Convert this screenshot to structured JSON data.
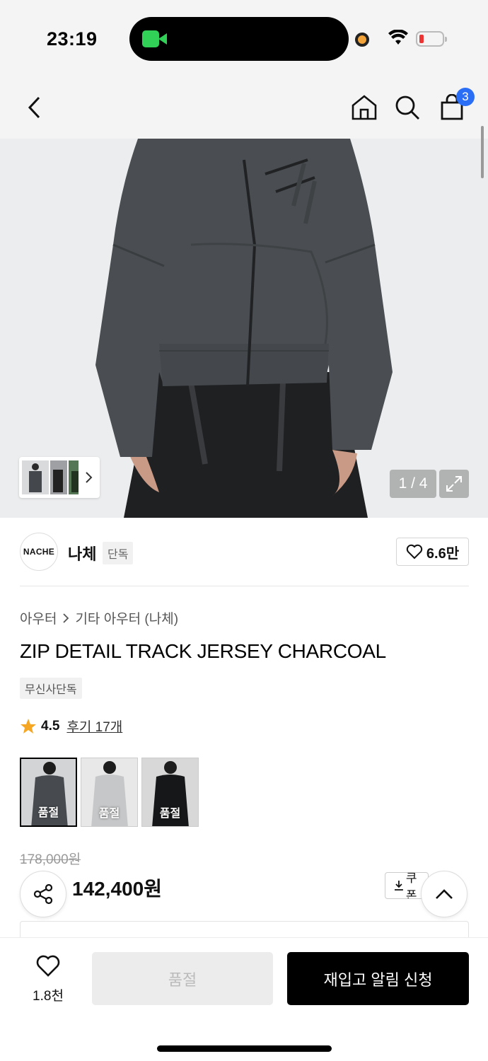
{
  "status": {
    "time": "23:19"
  },
  "nav": {
    "cart_count": "3"
  },
  "gallery": {
    "counter": "1 / 4"
  },
  "brand": {
    "logo_text": "NACHE",
    "name": "나체",
    "exclusive_badge": "단독",
    "likes": "6.6만"
  },
  "breadcrumb": {
    "category": "아우터",
    "subcategory": "기타 아우터 (나체)"
  },
  "product": {
    "title": "ZIP DETAIL TRACK JERSEY CHARCOAL",
    "badge": "무신사단독",
    "rating": "4.5",
    "reviews": "후기 17개",
    "color_options": [
      {
        "label": "품절",
        "selected": true
      },
      {
        "label": "품절",
        "selected": false
      },
      {
        "label": "품절",
        "selected": false
      }
    ],
    "original_price": "178,000원",
    "sale_price": "142,400원",
    "coupon_label": "쿠폰"
  },
  "bottom": {
    "wish_count": "1.8천",
    "soldout_label": "품절",
    "restock_label": "재입고 알림 신청"
  },
  "colors": {
    "accent_blue": "#2b6ef6",
    "primary_black": "#000000",
    "star": "#f5a623"
  }
}
